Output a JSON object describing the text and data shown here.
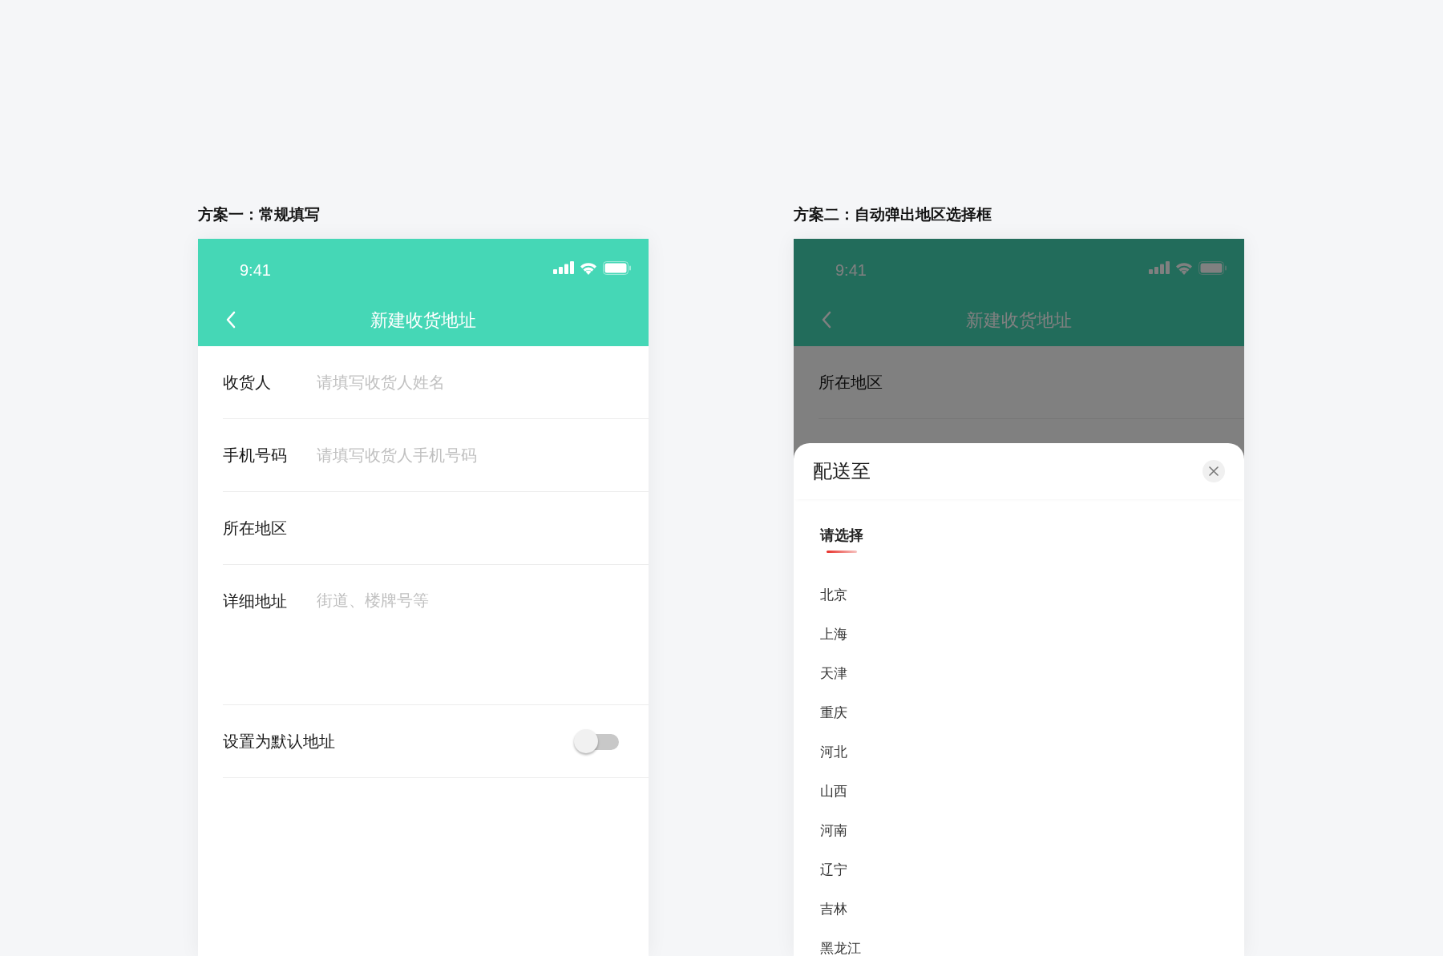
{
  "designs": [
    {
      "caption": "方案一：常规填写",
      "dimmed": false,
      "status_bar": {
        "time": "9:41"
      },
      "nav": {
        "title": "新建收货地址"
      },
      "form_rows": [
        {
          "kind": "input",
          "label": "收货人",
          "placeholder": "请填写收货人姓名"
        },
        {
          "kind": "input",
          "label": "手机号码",
          "placeholder": "请填写收货人手机号码"
        },
        {
          "kind": "picker",
          "label": "所在地区"
        },
        {
          "kind": "textarea",
          "label": "详细地址",
          "placeholder": "街道、楼牌号等"
        },
        {
          "kind": "switch",
          "label": "设置为默认地址",
          "on": false
        }
      ]
    },
    {
      "caption": "方案二：自动弹出地区选择框",
      "dimmed": true,
      "status_bar": {
        "time": "9:41"
      },
      "nav": {
        "title": "新建收货地址"
      },
      "form_rows": [
        {
          "kind": "picker",
          "label": "所在地区"
        }
      ],
      "sheet": {
        "title": "配送至",
        "tabs": [
          {
            "label": "请选择",
            "selected": true
          }
        ],
        "options": [
          "北京",
          "上海",
          "天津",
          "重庆",
          "河北",
          "山西",
          "河南",
          "辽宁",
          "吉林",
          "黑龙江"
        ]
      }
    }
  ]
}
